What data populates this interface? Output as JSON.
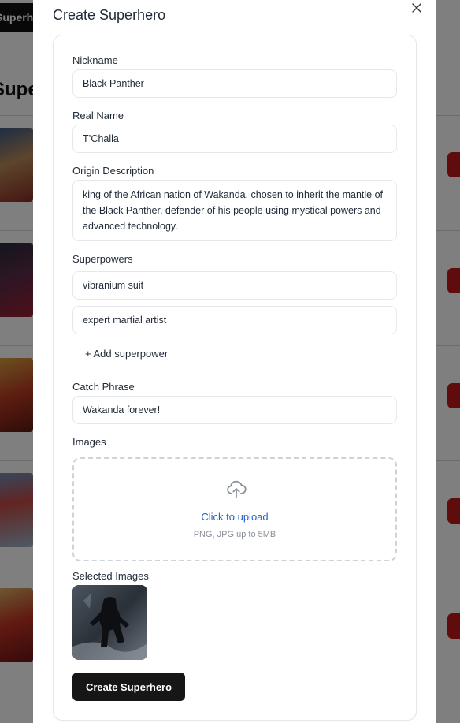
{
  "background": {
    "brand_text": "Superhero",
    "heading_text": "Superheroes"
  },
  "modal": {
    "title": "Create Superhero",
    "close_icon": "close-icon",
    "form": {
      "nickname": {
        "label": "Nickname",
        "value": "Black Panther"
      },
      "real_name": {
        "label": "Real Name",
        "value": "T’Challa"
      },
      "origin_description": {
        "label": "Origin Description",
        "value": "king of the African nation of Wakanda, chosen to inherit the mantle of the Black Panther, defender of his people using mystical powers and advanced technology."
      },
      "superpowers": {
        "label": "Superpowers",
        "items": [
          "vibranium suit",
          "expert martial artist"
        ],
        "add_label": "+ Add superpower"
      },
      "catch_phrase": {
        "label": "Catch Phrase",
        "value": "Wakanda forever!"
      },
      "images": {
        "label": "Images",
        "upload_icon": "upload-cloud-icon",
        "upload_link": "Click to upload",
        "upload_hint": "PNG, JPG up to 5MB"
      },
      "selected_images": {
        "label": "Selected Images"
      },
      "submit_label": "Create Superhero"
    }
  },
  "colors": {
    "accent_link": "#2563c9",
    "submit_bg": "#161616",
    "delete_red": "#c01818"
  }
}
